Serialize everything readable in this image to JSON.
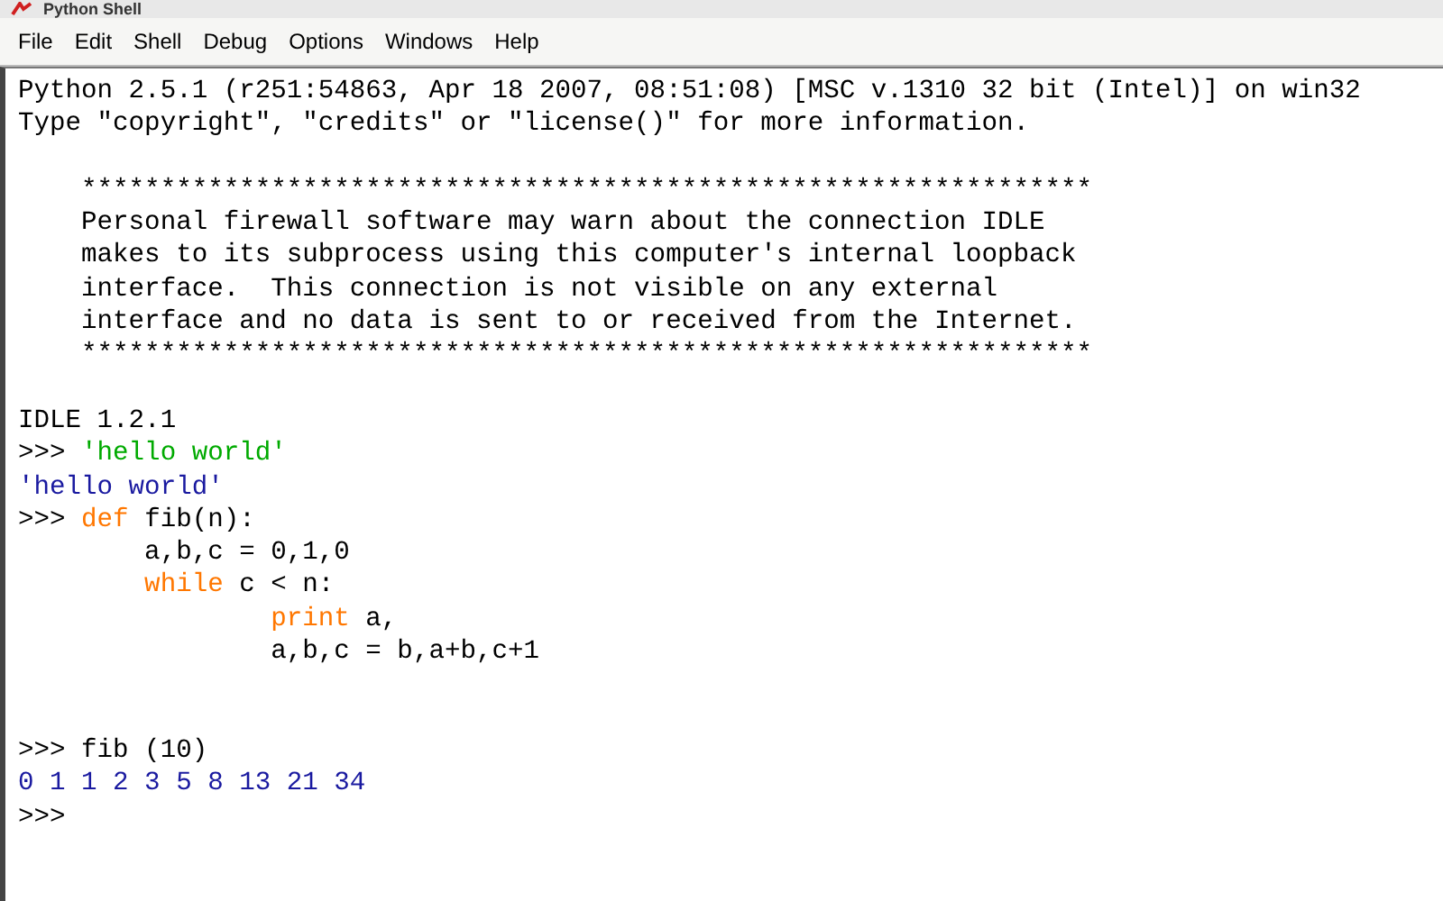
{
  "window": {
    "title": "Python Shell"
  },
  "menu": [
    "File",
    "Edit",
    "Shell",
    "Debug",
    "Options",
    "Windows",
    "Help"
  ],
  "shell": {
    "lines": [
      {
        "kind": "text",
        "segments": [
          {
            "kind": "output",
            "text": "Python 2.5.1 (r251:54863, Apr 18 2007, 08:51:08) [MSC v.1310 32 bit (Intel)] on win32"
          }
        ]
      },
      {
        "kind": "text",
        "segments": [
          {
            "kind": "output",
            "text": "Type \"copyright\", \"credits\" or \"license()\" for more information."
          }
        ]
      },
      {
        "kind": "blank"
      },
      {
        "kind": "text",
        "segments": [
          {
            "kind": "output",
            "text": "    ****************************************************************"
          }
        ]
      },
      {
        "kind": "text",
        "segments": [
          {
            "kind": "output",
            "text": "    Personal firewall software may warn about the connection IDLE"
          }
        ]
      },
      {
        "kind": "text",
        "segments": [
          {
            "kind": "output",
            "text": "    makes to its subprocess using this computer's internal loopback"
          }
        ]
      },
      {
        "kind": "text",
        "segments": [
          {
            "kind": "output",
            "text": "    interface.  This connection is not visible on any external"
          }
        ]
      },
      {
        "kind": "text",
        "segments": [
          {
            "kind": "output",
            "text": "    interface and no data is sent to or received from the Internet."
          }
        ]
      },
      {
        "kind": "text",
        "segments": [
          {
            "kind": "output",
            "text": "    ****************************************************************"
          }
        ]
      },
      {
        "kind": "blank"
      },
      {
        "kind": "text",
        "segments": [
          {
            "kind": "output",
            "text": "IDLE 1.2.1"
          }
        ]
      },
      {
        "kind": "text",
        "segments": [
          {
            "kind": "prompt",
            "text": ">>> "
          },
          {
            "kind": "string",
            "text": "'hello world'"
          }
        ]
      },
      {
        "kind": "text",
        "segments": [
          {
            "kind": "stdout",
            "text": "'hello world'"
          }
        ]
      },
      {
        "kind": "text",
        "segments": [
          {
            "kind": "prompt",
            "text": ">>> "
          },
          {
            "kind": "keyword",
            "text": "def"
          },
          {
            "kind": "code",
            "text": " fib(n):"
          }
        ]
      },
      {
        "kind": "text",
        "segments": [
          {
            "kind": "code",
            "text": "        a,b,c = 0,1,0"
          }
        ]
      },
      {
        "kind": "text",
        "segments": [
          {
            "kind": "keyword",
            "text": "        while"
          },
          {
            "kind": "code",
            "text": " c < n:"
          }
        ]
      },
      {
        "kind": "text",
        "segments": [
          {
            "kind": "keyword",
            "text": "                print"
          },
          {
            "kind": "code",
            "text": " a,"
          }
        ]
      },
      {
        "kind": "text",
        "segments": [
          {
            "kind": "code",
            "text": "                a,b,c = b,a+b,c+1"
          }
        ]
      },
      {
        "kind": "blank"
      },
      {
        "kind": "blank"
      },
      {
        "kind": "text",
        "segments": [
          {
            "kind": "prompt",
            "text": ">>> "
          },
          {
            "kind": "code",
            "text": "fib (10)"
          }
        ]
      },
      {
        "kind": "text",
        "segments": [
          {
            "kind": "stdout",
            "text": "0 1 1 2 3 5 8 13 21 34"
          }
        ]
      },
      {
        "kind": "text",
        "segments": [
          {
            "kind": "prompt",
            "text": ">>>"
          }
        ]
      }
    ]
  }
}
